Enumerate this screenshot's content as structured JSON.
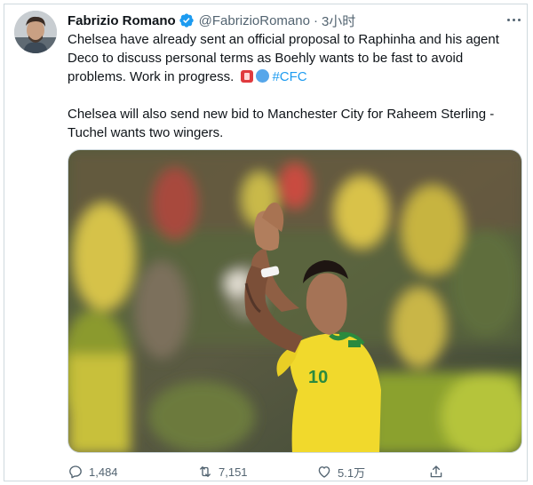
{
  "tweet": {
    "author_name": "Fabrizio Romano",
    "handle": "@FabrizioRomano",
    "separator": "·",
    "time": "3小时",
    "paragraph1_text": "Chelsea have already sent an official proposal to Raphinha and his agent Deco to discuss personal terms as Boehly wants to be fast to avoid problems. Work in progress.",
    "hashtag": "#CFC",
    "paragraph2_text": "Chelsea will also send new bid to Manchester City for Raheem Sterling - Tuchel wants two wingers.",
    "jersey_number": "10"
  },
  "actions": {
    "reply_count": "1,484",
    "retweet_count": "7,151",
    "like_count": "5.1万"
  },
  "icons": {
    "verified": "verified-badge-icon",
    "more": "more-icon",
    "emoji1": "red-flag-emoji-icon",
    "emoji2": "blue-circle-emoji-icon",
    "reply": "reply-icon",
    "retweet": "retweet-icon",
    "like": "like-icon",
    "share": "share-icon"
  },
  "colors": {
    "accent": "#1d9bf0",
    "text": "#0f1419",
    "secondary": "#536471",
    "border": "#cfd9de"
  }
}
